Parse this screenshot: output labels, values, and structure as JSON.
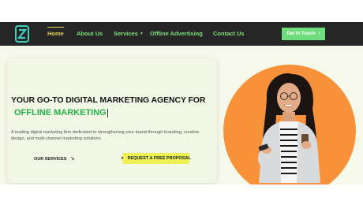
{
  "nav": {
    "items": [
      {
        "label": "Home",
        "active": true
      },
      {
        "label": "About Us"
      },
      {
        "label": "Services",
        "has_dropdown": true
      },
      {
        "label": "Offline Advertising"
      },
      {
        "label": "Contact Us"
      }
    ],
    "cta_label": "Get In Touch",
    "colors": {
      "bar": "#262626",
      "link": "#7ee07c",
      "active": "#e6d255",
      "cta": "#6edc7c"
    }
  },
  "hero": {
    "title": "YOUR GO-TO DIGITAL MARKETING AGENCY FOR",
    "highlight": "OFFLINE MARKETING",
    "description": "A leading digital marketing firm dedicated to strengthening your brand through branding, creative design, and multi-channel marketing solutions.",
    "services_link": "OUR SERVICES",
    "proposal_button": "REQUEST A FREE PROPOSAL",
    "colors": {
      "accent_green": "#26b04b",
      "circle": "#f7913a",
      "proposal": "#eef255"
    }
  },
  "icons": {
    "logo": "logo-z-icon",
    "cta_arrow": "chevron-right-icon",
    "services_arrow": "arrow-icon",
    "proposal": "double-chevron-icon"
  }
}
